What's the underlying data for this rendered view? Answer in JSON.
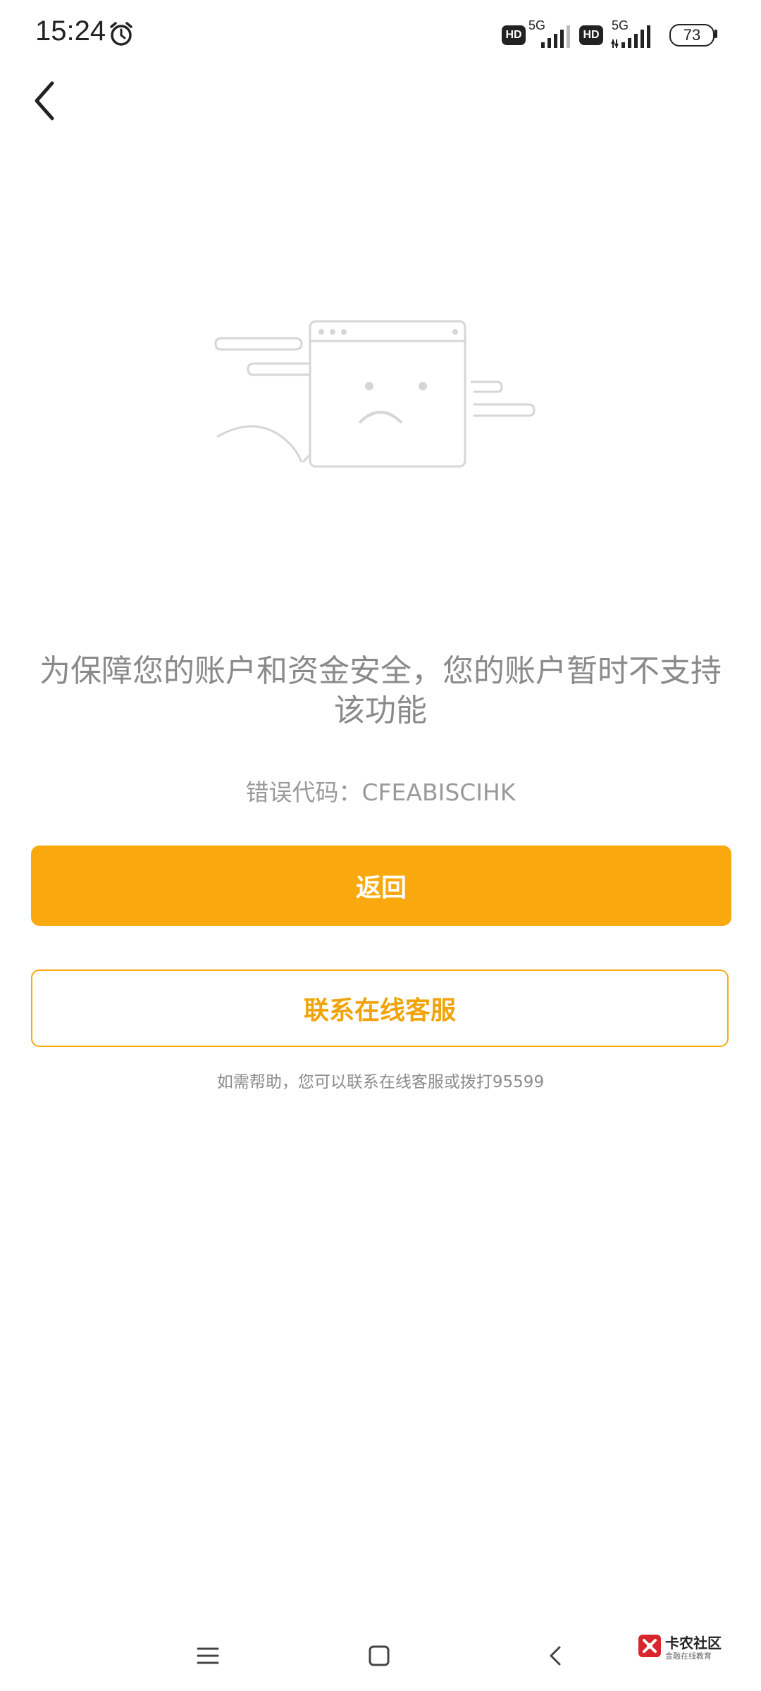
{
  "status_bar": {
    "time": "15:24",
    "sim1": {
      "hd": "HD",
      "network": "5G"
    },
    "sim2": {
      "hd": "HD",
      "network": "5G"
    },
    "battery": "73"
  },
  "icons": {
    "back": "chevron-left-icon",
    "alarm": "alarm-clock-icon",
    "illustration": "sad-browser-window-icon"
  },
  "error": {
    "message": "为保障您的账户和资金安全，您的账户暂时不支持该功能",
    "code_label": "错误代码：CFEABISCIHK"
  },
  "actions": {
    "return_label": "返回",
    "contact_label": "联系在线客服"
  },
  "help": {
    "text": "如需帮助，您可以联系在线客服或拨打95599"
  },
  "nav_bar": {
    "menu": "menu-icon",
    "home": "home-square-icon",
    "back": "back-triangle-icon"
  },
  "watermark": {
    "title": "卡农社区",
    "subtitle": "金融在线教育"
  },
  "colors": {
    "accent": "#f9a90e",
    "message_text": "#8a8a8a"
  }
}
